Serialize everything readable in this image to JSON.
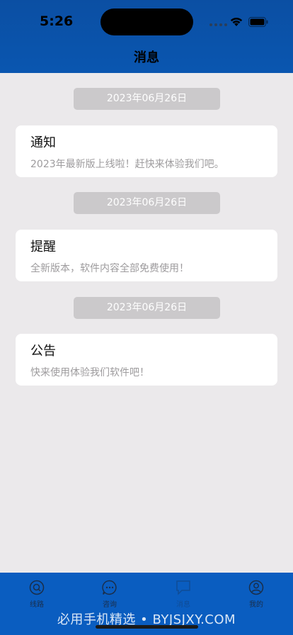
{
  "status": {
    "time": "5:26"
  },
  "nav": {
    "title": "消息"
  },
  "messages": [
    {
      "date": "2023年06月26日",
      "title": "通知",
      "body": "2023年最新版上线啦！赶快来体验我们吧。"
    },
    {
      "date": "2023年06月26日",
      "title": "提醒",
      "body": "全新版本，软件内容全部免费使用！"
    },
    {
      "date": "2023年06月26日",
      "title": "公告",
      "body": "快来使用体验我们软件吧！"
    }
  ],
  "tabs": [
    {
      "label": "线路",
      "icon": "route-icon"
    },
    {
      "label": "咨询",
      "icon": "chat-icon"
    },
    {
      "label": "消息",
      "icon": "message-icon"
    },
    {
      "label": "我的",
      "icon": "profile-icon"
    }
  ],
  "watermark": "必用手机精选 • BYJSJXY.COM",
  "colors": {
    "header": "#0b4fa3",
    "tabbar": "#0a5dc0",
    "background": "#ebe9eb"
  }
}
